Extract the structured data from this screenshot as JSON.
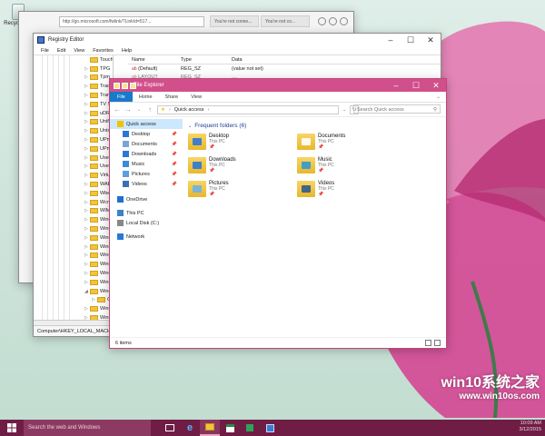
{
  "desktop": {
    "recycle_bin_label": "Recycle Bin"
  },
  "ie": {
    "address": "http://go.microsoft.com/fwlink/?LinkId=517...",
    "tabs": [
      "You're not conne...",
      "You're not co..."
    ]
  },
  "registry": {
    "title": "Registry Editor",
    "menu": [
      "File",
      "Edit",
      "View",
      "Favorites",
      "Help"
    ],
    "tree": [
      {
        "label": "TouchPrediction",
        "exp": ""
      },
      {
        "label": "TPG",
        "exp": "▷"
      },
      {
        "label": "Tpm",
        "exp": "▷"
      },
      {
        "label": "Tracing",
        "exp": "▷"
      },
      {
        "label": "Transactions",
        "exp": "▷"
      },
      {
        "label": "TV System Services",
        "exp": "▷"
      },
      {
        "label": "uDRM",
        "exp": "▷"
      },
      {
        "label": "Unified Store",
        "exp": "▷"
      },
      {
        "label": "Unistore",
        "exp": "▷"
      },
      {
        "label": "UPnP Control Point",
        "exp": "▷"
      },
      {
        "label": "UPnP Device Host",
        "exp": "▷"
      },
      {
        "label": "UserData",
        "exp": "▷"
      },
      {
        "label": "UserManager",
        "exp": "▷"
      },
      {
        "label": "Virtual Machine",
        "exp": "▷"
      },
      {
        "label": "WAB",
        "exp": "▷"
      },
      {
        "label": "Wbem",
        "exp": "▷"
      },
      {
        "label": "WcmSvc",
        "exp": "▷"
      },
      {
        "label": "WIMMount",
        "exp": "▷"
      },
      {
        "label": "Windows",
        "exp": "▷"
      },
      {
        "label": "Windows Defender",
        "exp": "▷"
      },
      {
        "label": "Windows Desktop Search",
        "exp": "▷"
      },
      {
        "label": "Windows Embedded",
        "exp": "▷"
      },
      {
        "label": "Windows Mail",
        "exp": "▷"
      },
      {
        "label": "Windows Media Device Manager",
        "exp": "▷"
      },
      {
        "label": "Windows Media Foundation",
        "exp": "▷"
      },
      {
        "label": "Windows Media Player NSS",
        "exp": "▷"
      },
      {
        "label": "Windows NT",
        "exp": "◢"
      },
      {
        "label": "CurrentVersion",
        "exp": "▷",
        "indent": true
      },
      {
        "label": "Windows Photo Viewer",
        "exp": "▷"
      },
      {
        "label": "Windows Portable Devices",
        "exp": "▷"
      },
      {
        "label": "Windows Script Host",
        "exp": "▷"
      },
      {
        "label": "Windows Search",
        "exp": "▷"
      },
      {
        "label": "Windows Security Health",
        "exp": "▷"
      }
    ],
    "columns": [
      "Name",
      "Type",
      "Data"
    ],
    "rows": [
      {
        "name": "(Default)",
        "type": "REG_SZ",
        "data": "(value not set)"
      },
      {
        "name": "LAYOUT",
        "type": "REG_SZ",
        "data": "...."
      }
    ],
    "status": "Computer\\HKEY_LOCAL_MACHINE\\SOFTWARE\\Microsoft\\Windows NT\\CurrentVersion"
  },
  "explorer": {
    "title": "File Explorer",
    "ribbon_tabs": [
      "File",
      "Home",
      "Share",
      "View"
    ],
    "address": "Quick access",
    "search_placeholder": "Search Quick access",
    "nav": [
      {
        "label": "Quick access",
        "icon": "star-icon",
        "color": "#f2c200",
        "pin": ""
      },
      {
        "label": "Desktop",
        "icon": "desktop-icon",
        "color": "#2a78d6",
        "pin": "📌"
      },
      {
        "label": "Documents",
        "icon": "documents-icon",
        "color": "#7aa4d8",
        "pin": "📌"
      },
      {
        "label": "Downloads",
        "icon": "downloads-icon",
        "color": "#2a78d6",
        "pin": "📌"
      },
      {
        "label": "Music",
        "icon": "music-icon",
        "color": "#3a8ad6",
        "pin": "📌"
      },
      {
        "label": "Pictures",
        "icon": "pictures-icon",
        "color": "#5aa0e0",
        "pin": "📌"
      },
      {
        "label": "Videos",
        "icon": "videos-icon",
        "color": "#3a6fb8",
        "pin": "📌"
      },
      {
        "label": "OneDrive",
        "icon": "onedrive-icon",
        "color": "#1f6fd1",
        "pin": ""
      },
      {
        "label": "This PC",
        "icon": "computer-icon",
        "color": "#3a82cc",
        "pin": ""
      },
      {
        "label": "Local Disk (C:)",
        "icon": "disk-icon",
        "color": "#888888",
        "pin": ""
      },
      {
        "label": "Network",
        "icon": "network-icon",
        "color": "#2a78d6",
        "pin": ""
      }
    ],
    "section_title": "Frequent folders (6)",
    "folders": [
      {
        "name": "Desktop",
        "loc": "This PC",
        "icon": "desktop-folder-icon",
        "accent": "#2a78d6"
      },
      {
        "name": "Documents",
        "loc": "This PC",
        "icon": "documents-folder-icon",
        "accent": "#ffffff"
      },
      {
        "name": "Downloads",
        "loc": "This PC",
        "icon": "downloads-folder-icon",
        "accent": "#2a78d6"
      },
      {
        "name": "Music",
        "loc": "This PC",
        "icon": "music-folder-icon",
        "accent": "#2f9ad1"
      },
      {
        "name": "Pictures",
        "loc": "This PC",
        "icon": "pictures-folder-icon",
        "accent": "#6fb1e8"
      },
      {
        "name": "Videos",
        "loc": "This PC",
        "icon": "videos-folder-icon",
        "accent": "#2d5b8f"
      }
    ],
    "status": "6 items"
  },
  "taskbar": {
    "search_placeholder": "Search the web and Windows",
    "time": "10:09 AM",
    "date": "3/12/2015"
  },
  "watermark": {
    "line1": "win10系统之家",
    "line2": "www.win10os.com"
  }
}
